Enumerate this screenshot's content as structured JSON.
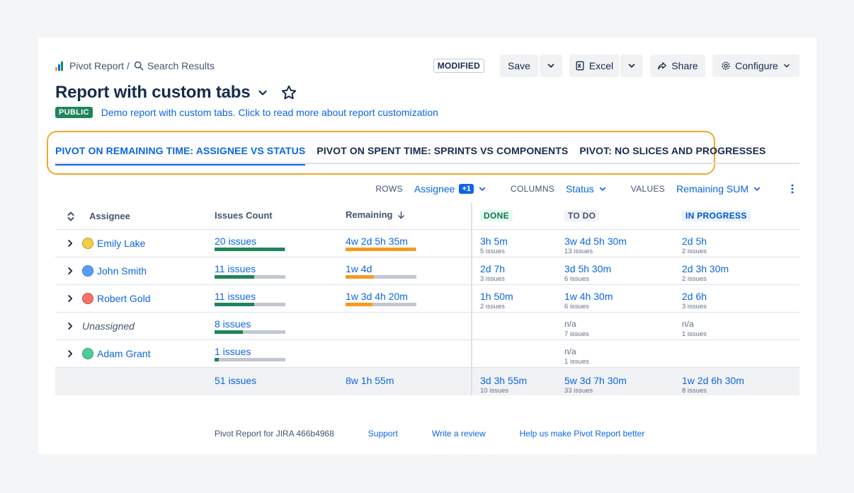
{
  "breadcrumb": {
    "root": "Pivot Report",
    "separator": "/",
    "current": "Search Results"
  },
  "status_badge": "MODIFIED",
  "actions": {
    "save": "Save",
    "excel": "Excel",
    "share": "Share",
    "configure": "Configure"
  },
  "report": {
    "title": "Report with custom tabs",
    "visibility": "PUBLIC",
    "description": "Demo report with custom tabs. Click to read more about report customization"
  },
  "tabs": [
    {
      "label": "PIVOT ON REMAINING TIME: ASSIGNEE VS STATUS",
      "active": true
    },
    {
      "label": "PIVOT ON SPENT TIME: SPRINTS VS COMPONENTS",
      "active": false
    },
    {
      "label": "PIVOT: NO SLICES AND PROGRESSES",
      "active": false
    }
  ],
  "controls": {
    "rows_label": "ROWS",
    "rows_value": "Assignee",
    "rows_extra": "+1",
    "columns_label": "COLUMNS",
    "columns_value": "Status",
    "values_label": "VALUES",
    "values_value": "Remaining SUM"
  },
  "columns": {
    "assignee": "Assignee",
    "issues_count": "Issues Count",
    "remaining": "Remaining",
    "status": [
      {
        "label": "DONE",
        "bg": "#dcfff1",
        "fg": "#216e4e"
      },
      {
        "label": "TO DO",
        "bg": "#f1f2f4",
        "fg": "#44546f"
      },
      {
        "label": "IN PROGRESS",
        "bg": "#e9f2ff",
        "fg": "#0055cc"
      }
    ]
  },
  "rows": [
    {
      "assignee": "Emily Lake",
      "avatar_color": "#f5cd47",
      "issues": "20 issues",
      "issues_progress": 1.0,
      "remaining": "4w 2d 5h 35m",
      "remaining_progress": 1.0,
      "done": {
        "value": "3h 5m",
        "sub": "5 issues"
      },
      "todo": {
        "value": "3w 4d 5h 30m",
        "sub": "13 issues"
      },
      "inprogress": {
        "value": "2d 5h",
        "sub": "2 issues"
      }
    },
    {
      "assignee": "John Smith",
      "avatar_color": "#579dff",
      "issues": "11 issues",
      "issues_progress": 0.56,
      "remaining": "1w 4d",
      "remaining_progress": 0.4,
      "done": {
        "value": "2d 7h",
        "sub": "3 issues"
      },
      "todo": {
        "value": "3d 5h 30m",
        "sub": "6 issues"
      },
      "inprogress": {
        "value": "2d 3h 30m",
        "sub": "2 issues"
      }
    },
    {
      "assignee": "Robert Gold",
      "avatar_color": "#f87168",
      "issues": "11 issues",
      "issues_progress": 0.56,
      "remaining": "1w 3d 4h 20m",
      "remaining_progress": 0.38,
      "done": {
        "value": "1h 50m",
        "sub": "2 issues"
      },
      "todo": {
        "value": "1w 4h 30m",
        "sub": "6 issues"
      },
      "inprogress": {
        "value": "2d 6h",
        "sub": "3 issues"
      }
    },
    {
      "assignee": "Unassigned",
      "avatar_color": "",
      "issues": "8 issues",
      "issues_progress": 0.4,
      "remaining": "",
      "remaining_progress": 0,
      "done": {
        "value": "",
        "sub": ""
      },
      "todo": {
        "value": "n/a",
        "sub": "7 issues"
      },
      "inprogress": {
        "value": "n/a",
        "sub": "1 issues"
      }
    },
    {
      "assignee": "Adam Grant",
      "avatar_color": "#4bce97",
      "issues": "1 issues",
      "issues_progress": 0.06,
      "remaining": "",
      "remaining_progress": 0,
      "done": {
        "value": "",
        "sub": ""
      },
      "todo": {
        "value": "n/a",
        "sub": "1 issues"
      },
      "inprogress": {
        "value": "",
        "sub": ""
      }
    }
  ],
  "totals": {
    "issues": "51 issues",
    "remaining": "8w 1h 55m",
    "done": {
      "value": "3d 3h 55m",
      "sub": "10 issues"
    },
    "todo": {
      "value": "5w 3d 7h 30m",
      "sub": "33 issues"
    },
    "inprogress": {
      "value": "1w 2d 6h 30m",
      "sub": "8 issues"
    }
  },
  "footer": {
    "version": "Pivot Report for JIRA 466b4968",
    "support": "Support",
    "review": "Write a review",
    "feedback": "Help us make Pivot Report better"
  },
  "colors": {
    "accent": "#0c66e4",
    "progress_green": "#1f845a",
    "progress_orange": "#f79a1d",
    "highlight": "#f0a730"
  }
}
